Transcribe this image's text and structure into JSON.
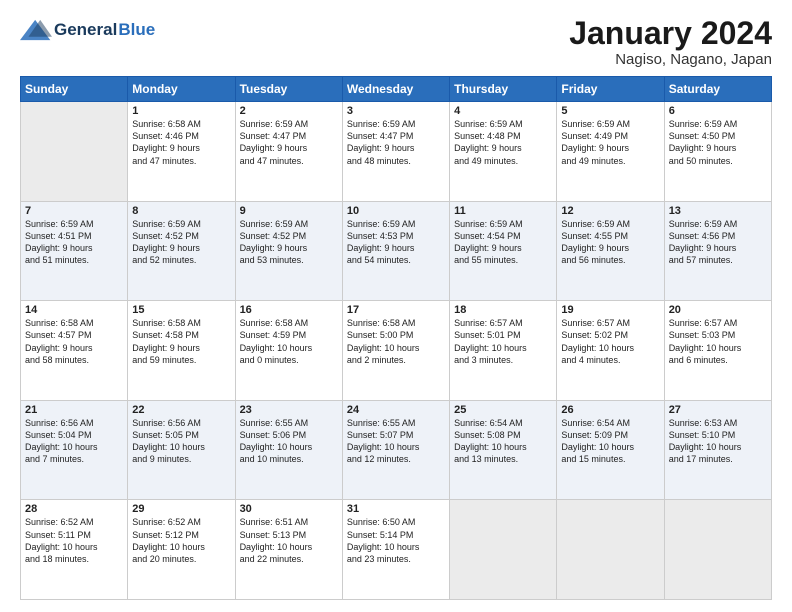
{
  "header": {
    "logo_line1": "General",
    "logo_line2": "Blue",
    "month": "January 2024",
    "location": "Nagiso, Nagano, Japan"
  },
  "weekdays": [
    "Sunday",
    "Monday",
    "Tuesday",
    "Wednesday",
    "Thursday",
    "Friday",
    "Saturday"
  ],
  "weeks": [
    [
      {
        "day": "",
        "info": ""
      },
      {
        "day": "1",
        "info": "Sunrise: 6:58 AM\nSunset: 4:46 PM\nDaylight: 9 hours\nand 47 minutes."
      },
      {
        "day": "2",
        "info": "Sunrise: 6:59 AM\nSunset: 4:47 PM\nDaylight: 9 hours\nand 47 minutes."
      },
      {
        "day": "3",
        "info": "Sunrise: 6:59 AM\nSunset: 4:47 PM\nDaylight: 9 hours\nand 48 minutes."
      },
      {
        "day": "4",
        "info": "Sunrise: 6:59 AM\nSunset: 4:48 PM\nDaylight: 9 hours\nand 49 minutes."
      },
      {
        "day": "5",
        "info": "Sunrise: 6:59 AM\nSunset: 4:49 PM\nDaylight: 9 hours\nand 49 minutes."
      },
      {
        "day": "6",
        "info": "Sunrise: 6:59 AM\nSunset: 4:50 PM\nDaylight: 9 hours\nand 50 minutes."
      }
    ],
    [
      {
        "day": "7",
        "info": "Sunrise: 6:59 AM\nSunset: 4:51 PM\nDaylight: 9 hours\nand 51 minutes."
      },
      {
        "day": "8",
        "info": "Sunrise: 6:59 AM\nSunset: 4:52 PM\nDaylight: 9 hours\nand 52 minutes."
      },
      {
        "day": "9",
        "info": "Sunrise: 6:59 AM\nSunset: 4:52 PM\nDaylight: 9 hours\nand 53 minutes."
      },
      {
        "day": "10",
        "info": "Sunrise: 6:59 AM\nSunset: 4:53 PM\nDaylight: 9 hours\nand 54 minutes."
      },
      {
        "day": "11",
        "info": "Sunrise: 6:59 AM\nSunset: 4:54 PM\nDaylight: 9 hours\nand 55 minutes."
      },
      {
        "day": "12",
        "info": "Sunrise: 6:59 AM\nSunset: 4:55 PM\nDaylight: 9 hours\nand 56 minutes."
      },
      {
        "day": "13",
        "info": "Sunrise: 6:59 AM\nSunset: 4:56 PM\nDaylight: 9 hours\nand 57 minutes."
      }
    ],
    [
      {
        "day": "14",
        "info": "Sunrise: 6:58 AM\nSunset: 4:57 PM\nDaylight: 9 hours\nand 58 minutes."
      },
      {
        "day": "15",
        "info": "Sunrise: 6:58 AM\nSunset: 4:58 PM\nDaylight: 9 hours\nand 59 minutes."
      },
      {
        "day": "16",
        "info": "Sunrise: 6:58 AM\nSunset: 4:59 PM\nDaylight: 10 hours\nand 0 minutes."
      },
      {
        "day": "17",
        "info": "Sunrise: 6:58 AM\nSunset: 5:00 PM\nDaylight: 10 hours\nand 2 minutes."
      },
      {
        "day": "18",
        "info": "Sunrise: 6:57 AM\nSunset: 5:01 PM\nDaylight: 10 hours\nand 3 minutes."
      },
      {
        "day": "19",
        "info": "Sunrise: 6:57 AM\nSunset: 5:02 PM\nDaylight: 10 hours\nand 4 minutes."
      },
      {
        "day": "20",
        "info": "Sunrise: 6:57 AM\nSunset: 5:03 PM\nDaylight: 10 hours\nand 6 minutes."
      }
    ],
    [
      {
        "day": "21",
        "info": "Sunrise: 6:56 AM\nSunset: 5:04 PM\nDaylight: 10 hours\nand 7 minutes."
      },
      {
        "day": "22",
        "info": "Sunrise: 6:56 AM\nSunset: 5:05 PM\nDaylight: 10 hours\nand 9 minutes."
      },
      {
        "day": "23",
        "info": "Sunrise: 6:55 AM\nSunset: 5:06 PM\nDaylight: 10 hours\nand 10 minutes."
      },
      {
        "day": "24",
        "info": "Sunrise: 6:55 AM\nSunset: 5:07 PM\nDaylight: 10 hours\nand 12 minutes."
      },
      {
        "day": "25",
        "info": "Sunrise: 6:54 AM\nSunset: 5:08 PM\nDaylight: 10 hours\nand 13 minutes."
      },
      {
        "day": "26",
        "info": "Sunrise: 6:54 AM\nSunset: 5:09 PM\nDaylight: 10 hours\nand 15 minutes."
      },
      {
        "day": "27",
        "info": "Sunrise: 6:53 AM\nSunset: 5:10 PM\nDaylight: 10 hours\nand 17 minutes."
      }
    ],
    [
      {
        "day": "28",
        "info": "Sunrise: 6:52 AM\nSunset: 5:11 PM\nDaylight: 10 hours\nand 18 minutes."
      },
      {
        "day": "29",
        "info": "Sunrise: 6:52 AM\nSunset: 5:12 PM\nDaylight: 10 hours\nand 20 minutes."
      },
      {
        "day": "30",
        "info": "Sunrise: 6:51 AM\nSunset: 5:13 PM\nDaylight: 10 hours\nand 22 minutes."
      },
      {
        "day": "31",
        "info": "Sunrise: 6:50 AM\nSunset: 5:14 PM\nDaylight: 10 hours\nand 23 minutes."
      },
      {
        "day": "",
        "info": ""
      },
      {
        "day": "",
        "info": ""
      },
      {
        "day": "",
        "info": ""
      }
    ]
  ]
}
